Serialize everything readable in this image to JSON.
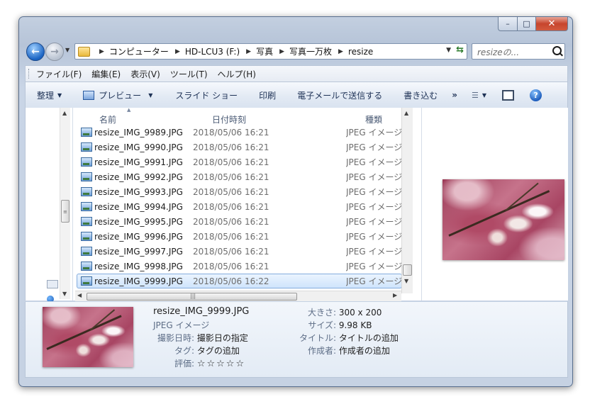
{
  "window": {
    "caption_buttons": {
      "minimize": "–",
      "maximize": "□",
      "close": "✕"
    }
  },
  "nav": {
    "back_glyph": "←",
    "forward_glyph": "→",
    "breadcrumbs": [
      "コンピューター",
      "HD-LCU3 (F:)",
      "写真",
      "写真一万枚",
      "resize"
    ],
    "search_placeholder": "resizeの...",
    "refresh_glyph": "⇆"
  },
  "menubar": [
    "ファイル(F)",
    "編集(E)",
    "表示(V)",
    "ツール(T)",
    "ヘルプ(H)"
  ],
  "toolbar": {
    "organize": "整理",
    "preview": "プレビュー",
    "slideshow": "スライド ショー",
    "print": "印刷",
    "email": "電子メールで送信する",
    "burn": "書き込む",
    "more": "»",
    "help": "?"
  },
  "columns": {
    "name": "名前",
    "date": "日付時刻",
    "type": "種類"
  },
  "files": [
    {
      "name": "resize_IMG_9989.JPG",
      "date": "2018/05/06 16:21",
      "type": "JPEG イメージ"
    },
    {
      "name": "resize_IMG_9990.JPG",
      "date": "2018/05/06 16:21",
      "type": "JPEG イメージ"
    },
    {
      "name": "resize_IMG_9991.JPG",
      "date": "2018/05/06 16:21",
      "type": "JPEG イメージ"
    },
    {
      "name": "resize_IMG_9992.JPG",
      "date": "2018/05/06 16:21",
      "type": "JPEG イメージ"
    },
    {
      "name": "resize_IMG_9993.JPG",
      "date": "2018/05/06 16:21",
      "type": "JPEG イメージ"
    },
    {
      "name": "resize_IMG_9994.JPG",
      "date": "2018/05/06 16:21",
      "type": "JPEG イメージ"
    },
    {
      "name": "resize_IMG_9995.JPG",
      "date": "2018/05/06 16:21",
      "type": "JPEG イメージ"
    },
    {
      "name": "resize_IMG_9996.JPG",
      "date": "2018/05/06 16:21",
      "type": "JPEG イメージ"
    },
    {
      "name": "resize_IMG_9997.JPG",
      "date": "2018/05/06 16:21",
      "type": "JPEG イメージ"
    },
    {
      "name": "resize_IMG_9998.JPG",
      "date": "2018/05/06 16:21",
      "type": "JPEG イメージ"
    },
    {
      "name": "resize_IMG_9999.JPG",
      "date": "2018/05/06 16:22",
      "type": "JPEG イメージ",
      "selected": true
    }
  ],
  "details": {
    "name": "resize_IMG_9999.JPG",
    "type": "JPEG イメージ",
    "shot_date_label": "撮影日時:",
    "shot_date_value": "撮影日の指定",
    "tags_label": "タグ:",
    "tags_value": "タグの追加",
    "rating_label": "評価:",
    "rating_stars": "☆☆☆☆☆",
    "dimensions_label": "大きさ:",
    "dimensions_value": "300 x 200",
    "size_label": "サイズ:",
    "size_value": "9.98 KB",
    "title_label": "タイトル:",
    "title_value": "タイトルの追加",
    "author_label": "作成者:",
    "author_value": "作成者の追加"
  }
}
